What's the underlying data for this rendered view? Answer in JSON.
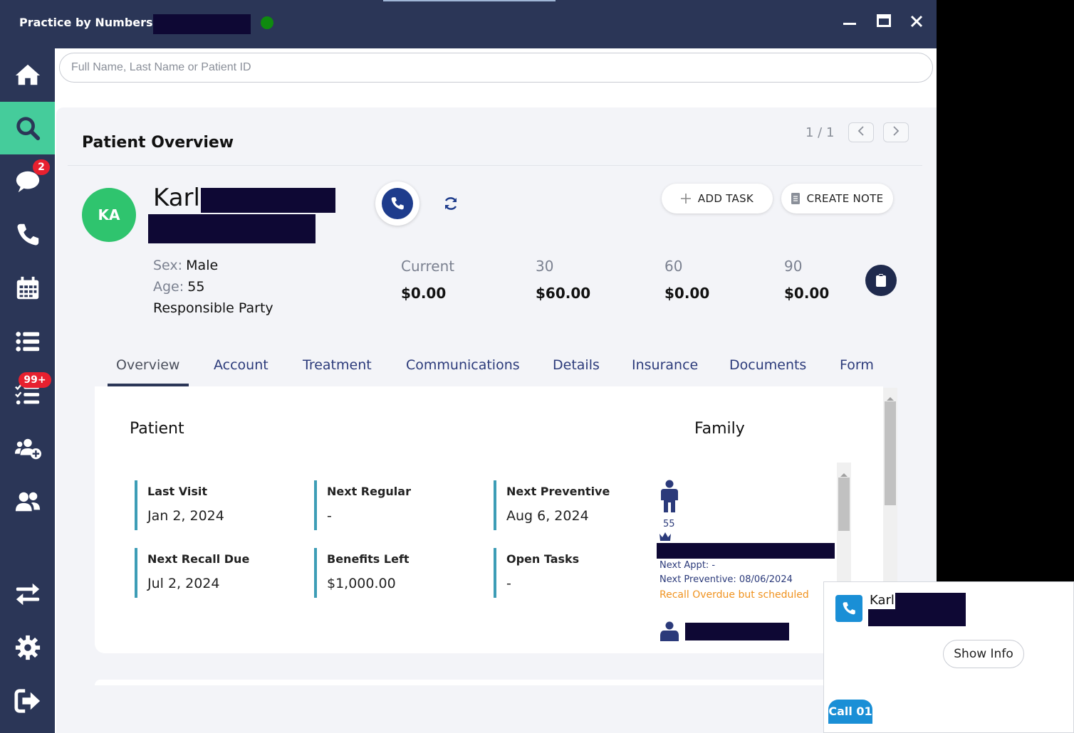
{
  "window": {
    "title": "Practice by Numbers –"
  },
  "search": {
    "placeholder": "Full Name, Last Name or Patient ID"
  },
  "sidebar": {
    "items": [
      {
        "name": "home",
        "badge": ""
      },
      {
        "name": "search",
        "badge": ""
      },
      {
        "name": "messages",
        "badge": "2"
      },
      {
        "name": "calls",
        "badge": ""
      },
      {
        "name": "calendar",
        "badge": ""
      },
      {
        "name": "list",
        "badge": ""
      },
      {
        "name": "tasks",
        "badge": "99+"
      },
      {
        "name": "add-user",
        "badge": ""
      },
      {
        "name": "users",
        "badge": ""
      },
      {
        "name": "transfer",
        "badge": ""
      },
      {
        "name": "settings",
        "badge": ""
      },
      {
        "name": "logout",
        "badge": ""
      }
    ]
  },
  "overview": {
    "title": "Patient Overview",
    "pager": "1 / 1"
  },
  "patient": {
    "initials": "KA",
    "first_name": "Karl",
    "sex_label": "Sex:",
    "sex": "Male",
    "age_label": "Age:",
    "age": "55",
    "responsible": "Responsible Party"
  },
  "actions": {
    "add_task": "ADD TASK",
    "create_note": "CREATE NOTE"
  },
  "aging": [
    {
      "label": "Current",
      "value": "$0.00"
    },
    {
      "label": "30",
      "value": "$60.00"
    },
    {
      "label": "60",
      "value": "$0.00"
    },
    {
      "label": "90",
      "value": "$0.00"
    }
  ],
  "tabs": [
    "Overview",
    "Account",
    "Treatment",
    "Communications",
    "Details",
    "Insurance",
    "Documents",
    "Form"
  ],
  "patient_section": {
    "title": "Patient",
    "stats": [
      {
        "label": "Last Visit",
        "value": "Jan 2, 2024"
      },
      {
        "label": "Next Regular",
        "value": "-"
      },
      {
        "label": "Next Preventive",
        "value": "Aug 6, 2024"
      },
      {
        "label": "Next Recall Due",
        "value": "Jul 2, 2024"
      },
      {
        "label": "Benefits Left",
        "value": "$1,000.00"
      },
      {
        "label": "Open Tasks",
        "value": "-"
      }
    ]
  },
  "family": {
    "title": "Family",
    "member_age": "55",
    "next_appt": "Next Appt: -",
    "next_preventive": "Next Preventive: 08/06/2024",
    "recall_status": "Recall Overdue but scheduled"
  },
  "call_popup": {
    "name": "Karl",
    "show_info": "Show Info",
    "call_tag": "Call 01"
  },
  "colors": {
    "navy": "#2b3657",
    "active_green": "#45cc9b",
    "avatar_green": "#2fc46e",
    "badge_red": "#e7202f",
    "accent_teal": "#3d9db6",
    "warning_orange": "#f0921e"
  }
}
